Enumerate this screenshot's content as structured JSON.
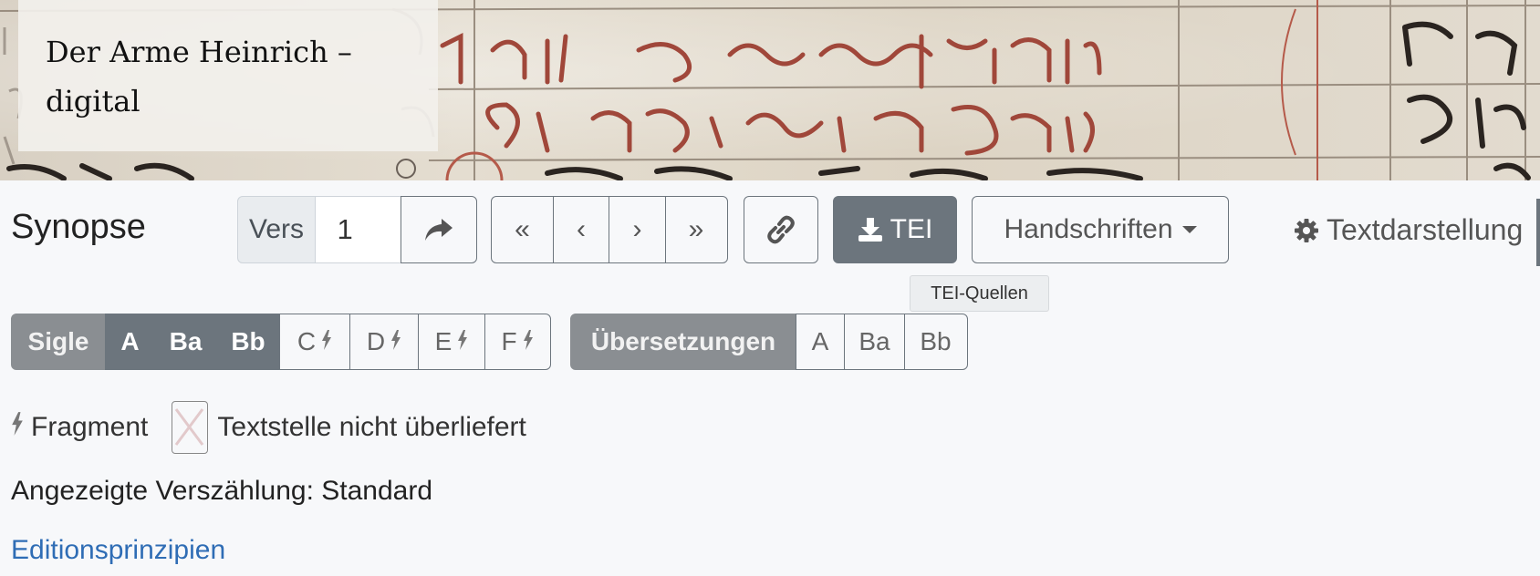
{
  "header": {
    "site_title": "Der Arme Heinrich – digital"
  },
  "toolbar": {
    "page_title": "Synopse",
    "verse_label": "Vers",
    "verse_value": "1",
    "go_icon": "share-arrow-icon",
    "nav": {
      "first": "«",
      "prev": "‹",
      "next": "›",
      "last": "»"
    },
    "link_icon": "link-icon",
    "tei_label": "TEI",
    "tei_icon": "download-icon",
    "tei_tooltip": "TEI-Quellen",
    "manuscripts_label": "Handschriften",
    "text_display_label": "Textdarstellung",
    "text_display_icon": "gear-icon"
  },
  "sigle_group": {
    "label": "Sigle",
    "items": [
      {
        "label": "A",
        "active": true,
        "fragment": false
      },
      {
        "label": "Ba",
        "active": true,
        "fragment": false
      },
      {
        "label": "Bb",
        "active": true,
        "fragment": false
      },
      {
        "label": "C",
        "active": false,
        "fragment": true
      },
      {
        "label": "D",
        "active": false,
        "fragment": true
      },
      {
        "label": "E",
        "active": false,
        "fragment": true
      },
      {
        "label": "F",
        "active": false,
        "fragment": true
      }
    ]
  },
  "translation_group": {
    "label": "Übersetzungen",
    "items": [
      {
        "label": "A"
      },
      {
        "label": "Ba"
      },
      {
        "label": "Bb"
      }
    ]
  },
  "legend": {
    "fragment_label": "Fragment",
    "fragment_icon": "bolt-icon",
    "not_transmitted_label": "Textstelle nicht überliefert"
  },
  "info": {
    "verse_numbering": "Angezeigte Verszählung: Standard"
  },
  "links": {
    "edition_principles": "Editionsprinzipien"
  },
  "colors": {
    "secondary": "#6c757d",
    "link": "#2f6db5",
    "ink_red": "#a0473a"
  }
}
